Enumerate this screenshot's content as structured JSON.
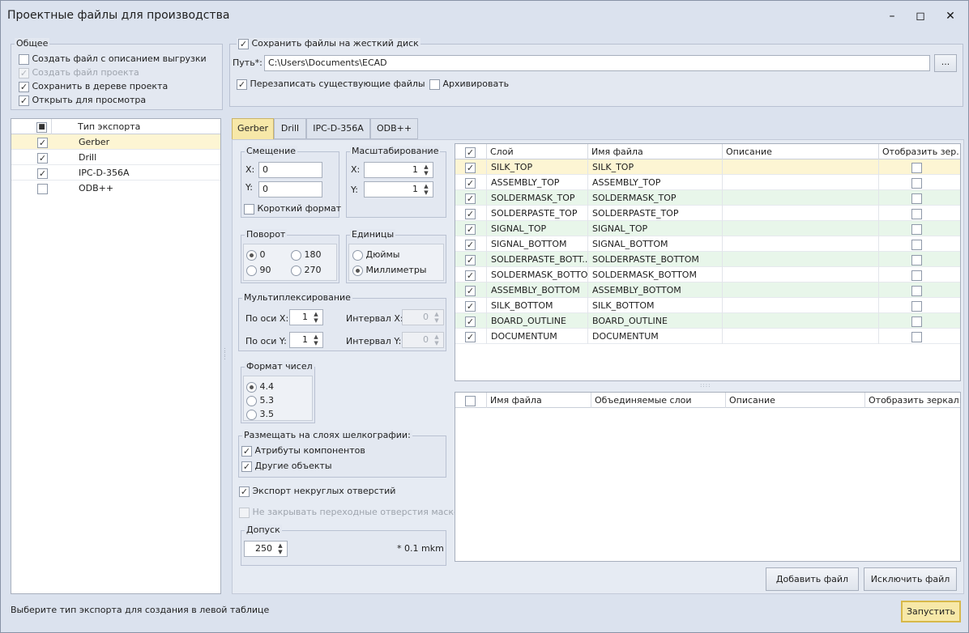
{
  "window": {
    "title": "Проектные файлы для производства"
  },
  "general": {
    "title": "Общее",
    "items": [
      {
        "label": "Создать файл с описанием выгрузки",
        "checked": false,
        "disabled": false
      },
      {
        "label": "Создать файл проекта",
        "checked": true,
        "disabled": true
      },
      {
        "label": "Сохранить в дереве проекта",
        "checked": true,
        "disabled": false
      },
      {
        "label": "Открыть для просмотра",
        "checked": true,
        "disabled": false
      }
    ]
  },
  "save": {
    "save_label": "Сохранить файлы на жесткий диск",
    "path_label": "Путь*:",
    "path_value": "C:\\Users\\Documents\\ECAD",
    "browse_label": "...",
    "overwrite_label": "Перезаписать существующие файлы",
    "archive_label": "Архивировать"
  },
  "export_types": {
    "header": "Тип экспорта",
    "items": [
      {
        "label": "Gerber",
        "checked": true
      },
      {
        "label": "Drill",
        "checked": true
      },
      {
        "label": "IPC-D-356A",
        "checked": true
      },
      {
        "label": "ODB++",
        "checked": false
      }
    ]
  },
  "tabs": [
    "Gerber",
    "Drill",
    "IPC-D-356A",
    "ODB++"
  ],
  "offset": {
    "title": "Смещение",
    "x_label": "X:",
    "x": "0",
    "y_label": "Y:",
    "y": "0",
    "short_label": "Короткий формат"
  },
  "scale": {
    "title": "Масштабирование",
    "x_label": "X:",
    "x": "1",
    "y_label": "Y:",
    "y": "1"
  },
  "rotation": {
    "title": "Поворот",
    "options": [
      "0",
      "180",
      "90",
      "270"
    ],
    "selected": "0"
  },
  "units": {
    "title": "Единицы",
    "options": [
      "Дюймы",
      "Миллиметры"
    ],
    "selected": "Миллиметры"
  },
  "multiplex": {
    "title": "Мультиплексирование",
    "x_label": "По оси X:",
    "x": "1",
    "y_label": "По оси Y:",
    "y": "1",
    "ix_label": "Интервал X:",
    "ix": "0",
    "iy_label": "Интервал Y:",
    "iy": "0"
  },
  "number_format": {
    "title": "Формат чисел",
    "options": [
      "4.4",
      "5.3",
      "3.5"
    ],
    "selected": "4.4"
  },
  "silkscreen": {
    "title": "Размещать на слоях шелкографии:",
    "attributes": "Атрибуты компонентов",
    "other": "Другие объекты"
  },
  "export_nonround": "Экспорт некруглых отверстий",
  "no_mask_vias": "Не закрывать переходные отверстия маской",
  "tolerance": {
    "title": "Допуск",
    "value": "250",
    "unit": "* 0.1 mkm"
  },
  "layers_table": {
    "headers": [
      "Слой",
      "Имя файла",
      "Описание",
      "Отобразить зер..."
    ],
    "rows": [
      {
        "layer": "SILK_TOP",
        "file": "SILK_TOP"
      },
      {
        "layer": "ASSEMBLY_TOP",
        "file": "ASSEMBLY_TOP"
      },
      {
        "layer": "SOLDERMASK_TOP",
        "file": "SOLDERMASK_TOP"
      },
      {
        "layer": "SOLDERPASTE_TOP",
        "file": "SOLDERPASTE_TOP"
      },
      {
        "layer": "SIGNAL_TOP",
        "file": "SIGNAL_TOP"
      },
      {
        "layer": "SIGNAL_BOTTOM",
        "file": "SIGNAL_BOTTOM"
      },
      {
        "layer": "SOLDERPASTE_BOTT...",
        "file": "SOLDERPASTE_BOTTOM"
      },
      {
        "layer": "SOLDERMASK_BOTTOM",
        "file": "SOLDERMASK_BOTTOM"
      },
      {
        "layer": "ASSEMBLY_BOTTOM",
        "file": "ASSEMBLY_BOTTOM"
      },
      {
        "layer": "SILK_BOTTOM",
        "file": "SILK_BOTTOM"
      },
      {
        "layer": "BOARD_OUTLINE",
        "file": "BOARD_OUTLINE"
      },
      {
        "layer": "DOCUMENTUM",
        "file": "DOCUMENTUM"
      }
    ]
  },
  "files_table": {
    "headers": [
      "Имя файла",
      "Объединяемые слои",
      "Описание",
      "Отобразить зеркал..."
    ]
  },
  "buttons": {
    "add": "Добавить файл",
    "exclude": "Исключить файл",
    "run": "Запустить"
  },
  "status": "Выберите тип экспорта для создания в левой таблице",
  "colors": {
    "selected_row": "#fdf5d3",
    "alt_row": "#e8f6ea",
    "active_tab": "#f7e8a8"
  }
}
